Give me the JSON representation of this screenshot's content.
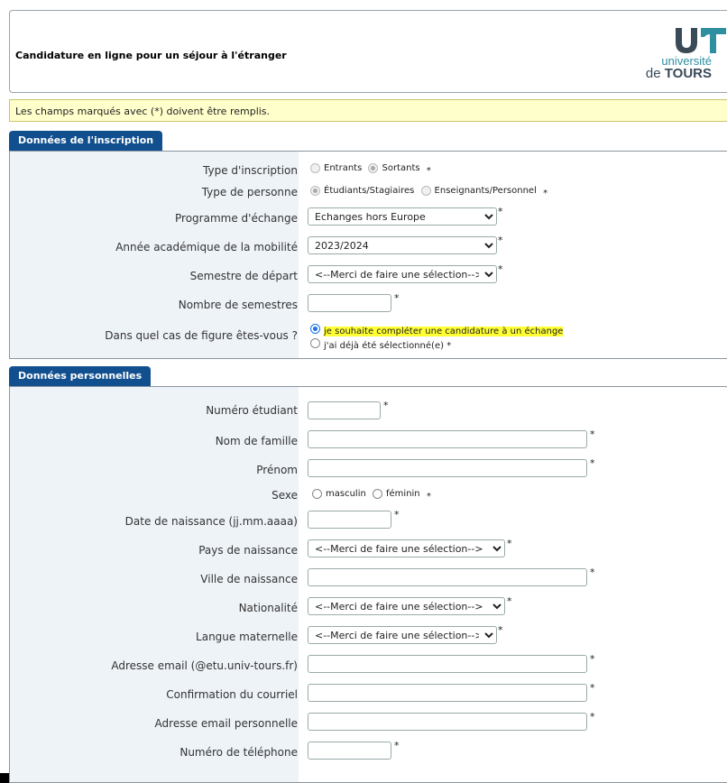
{
  "header": {
    "title": "Candidature en ligne pour un séjour à l'étranger",
    "logo_line1": "université",
    "logo_line2a": "de",
    "logo_line2b": "TOURS"
  },
  "notice": "Les champs marqués avec (*) doivent être remplis.",
  "colors": {
    "tab": "#124f8e",
    "label_bg": "#eef3f8",
    "notice_bg": "#ffffcc",
    "highlight": "#ffff33",
    "logo_teal": "#2e8fa0",
    "logo_dark": "#3a4a57"
  },
  "required_mark": "*",
  "section1": {
    "title": "Données de l'inscription",
    "type_inscription": {
      "label": "Type d'inscription",
      "opt1": "Entrants",
      "opt2": "Sortants"
    },
    "type_personne": {
      "label": "Type de personne",
      "opt1": "Étudiants/Stagiaires",
      "opt2": "Enseignants/Personnel"
    },
    "programme": {
      "label": "Programme d'échange",
      "value": "Echanges hors Europe"
    },
    "annee": {
      "label": "Année académique de la mobilité",
      "value": "2023/2024"
    },
    "semestre": {
      "label": "Semestre de départ",
      "value": "<--Merci de faire une sélection-->"
    },
    "nb_semestres": {
      "label": "Nombre de semestres"
    },
    "cas": {
      "label": "Dans quel cas de figure êtes-vous ?",
      "opt1": "je souhaite compléter une candidature à un échange",
      "opt2": "j'ai déjà été sélectionné(e)"
    }
  },
  "section2": {
    "title": "Données personnelles",
    "numero": {
      "label": "Numéro étudiant"
    },
    "nom": {
      "label": "Nom de famille"
    },
    "prenom": {
      "label": "Prénom"
    },
    "sexe": {
      "label": "Sexe",
      "opt1": "masculin",
      "opt2": "féminin"
    },
    "naissance": {
      "label": "Date de naissance (jj.mm.aaaa)"
    },
    "pays": {
      "label": "Pays de naissance",
      "value": "<--Merci de faire une sélection-->"
    },
    "ville": {
      "label": "Ville de naissance"
    },
    "nationalite": {
      "label": "Nationalité",
      "value": "<--Merci de faire une sélection-->"
    },
    "langue": {
      "label": "Langue maternelle",
      "value": "<--Merci de faire une sélection-->"
    },
    "email": {
      "label": "Adresse email (@etu.univ-tours.fr)"
    },
    "confirm": {
      "label": "Confirmation du courriel"
    },
    "email_perso": {
      "label": "Adresse email personnelle"
    },
    "telephone": {
      "label": "Numéro de téléphone"
    }
  }
}
